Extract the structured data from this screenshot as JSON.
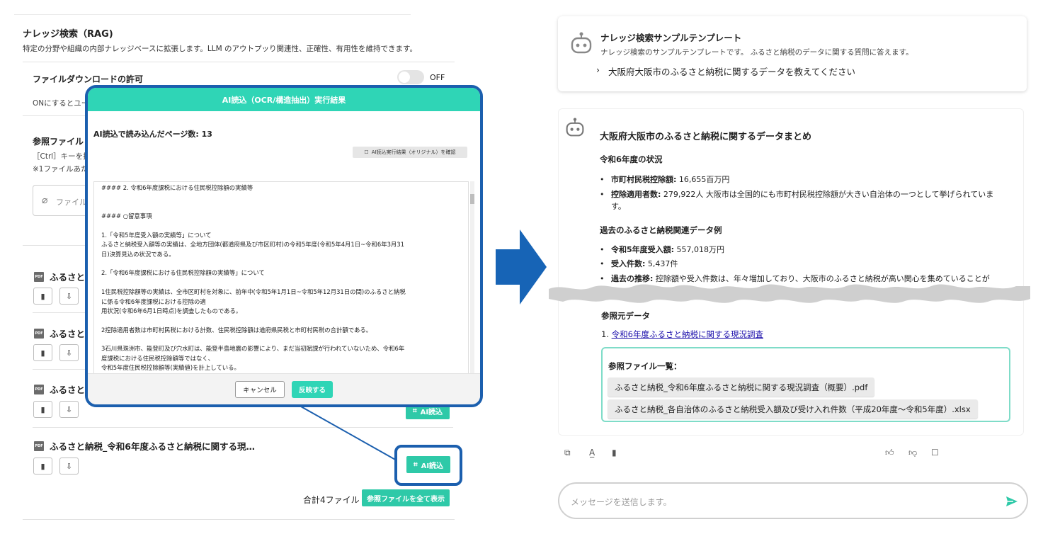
{
  "left_panel": {
    "title": "ナレッジ検索（RAG)",
    "description": "特定の分野や組織の内部ナレッジベースに拡張します。LLM のアウトプッり関連性、正確性、有用性を維持できます。",
    "download_permission": {
      "label": "ファイルダウンロードの許可",
      "toggle_state": "OFF",
      "hint": "ONにするとユー"
    },
    "reference_files": {
      "label": "参照ファイル",
      "hint_ctrl": "［Ctrl］キーを押",
      "hint_limit": "※1ファイルあた",
      "upload_placeholder": "ファイル"
    },
    "files": [
      {
        "name": "ふるさと"
      },
      {
        "name": "ふるさと"
      },
      {
        "name": "ふるさと"
      },
      {
        "name": "ふるさと納税_令和6年度ふるさと納税に関する現…"
      }
    ],
    "ai_read_label": "AI読込",
    "file_count_label": "合計4ファイル",
    "show_all_label": "参照ファイルを全て表示"
  },
  "modal": {
    "title": "AI読込（OCR/構造抽出）実行結果",
    "pages_read": "AI読込で読み込んだページ数: 13",
    "view_original_label": "AI読込実行結果（オリジナル）を確認",
    "content_lines": [
      "#### 2. 令和6年度課税における住民税控除額の実績等",
      "",
      "",
      "#### ○留意事項",
      "",
      "1.「令和5年度受入額の実績等」について",
      "ふるさと納税受入額等の実績は、全地方団体(都道府県及び市区町村)の令和5年度(令和5年4月1日~令和6年3月31",
      "日)決算見込の状況である。",
      "",
      "2.「令和6年度課税における住民税控除額の実績等」について",
      "",
      "1住民税控除額等の実績は、全市区町村を対象に、前年中(令和5年1月1日~令和5年12月31日の間)のふるさと納税",
      "に係る令和6年度課税における控除の適",
      "用状況(令和6年6月1日時点)を調査したものである。",
      "",
      "2控除適用者数は市町村民税における計数、住民税控除額は道府県民税と市町村民税の合計額である。",
      "",
      "3石川県珠洲市、能登町及び穴水町は、能登半島地震の影響により、まだ当初賦課が行われていないため、令和6年",
      "度課税における住民税控除額等ではなく、",
      "令和5年度住民税控除額等(実績値)を計上している。"
    ],
    "cancel_label": "キャンセル",
    "apply_label": "反映する"
  },
  "template_card": {
    "title": "ナレッジ検索サンプルテンプレート",
    "description": "ナレッジ検索のサンプルテンプレートです。 ふるさと納税のデータに関する質問に答えます。",
    "prompt": "大阪府大阪市のふるさと納税に関するデータを教えてください"
  },
  "answer": {
    "title": "大阪府大阪市のふるさと納税に関するデータまとめ",
    "section1_heading": "令和6年度の状況",
    "section1_items": [
      {
        "label": "市町村民税控除額:",
        "value": " 16,655百万円"
      },
      {
        "label": "控除適用者数:",
        "value": " 279,922人 大阪市は全国的にも市町村民税控除額が大きい自治体の一つとして挙げられていま"
      },
      {
        "label": "",
        "value": "す。"
      }
    ],
    "section2_heading": "過去のふるさと納税関連データ例",
    "section2_items": [
      {
        "label": "令和5年度受入額:",
        "value": " 557,018万円"
      },
      {
        "label": "受入件数:",
        "value": " 5,437件"
      },
      {
        "label": "過去の推移:",
        "value": " 控除額や受入件数は、年々増加しており、大阪市のふるさと納税が高い関心を集めていることが"
      }
    ],
    "sources_heading": "参照元データ",
    "sources": [
      {
        "index": "1.",
        "text": "令和6年度ふるさと納税に関する現況調査"
      }
    ],
    "ref_files_heading": "参照ファイル一覧：",
    "ref_files": [
      "ふるさと納税_令和6年度ふるさと納税に関する現況調査（概要）.pdf",
      "ふるさと納税_各自治体のふるさと納税受入額及び受け入れ件数（平成20年度～令和5年度）.xlsx"
    ]
  },
  "composer": {
    "placeholder": "メッセージを送信します。"
  },
  "colors": {
    "accent": "#2fd5b6",
    "highlight_border": "#1b5fae",
    "arrow": "#1764b6",
    "link": "#1a0dab"
  }
}
